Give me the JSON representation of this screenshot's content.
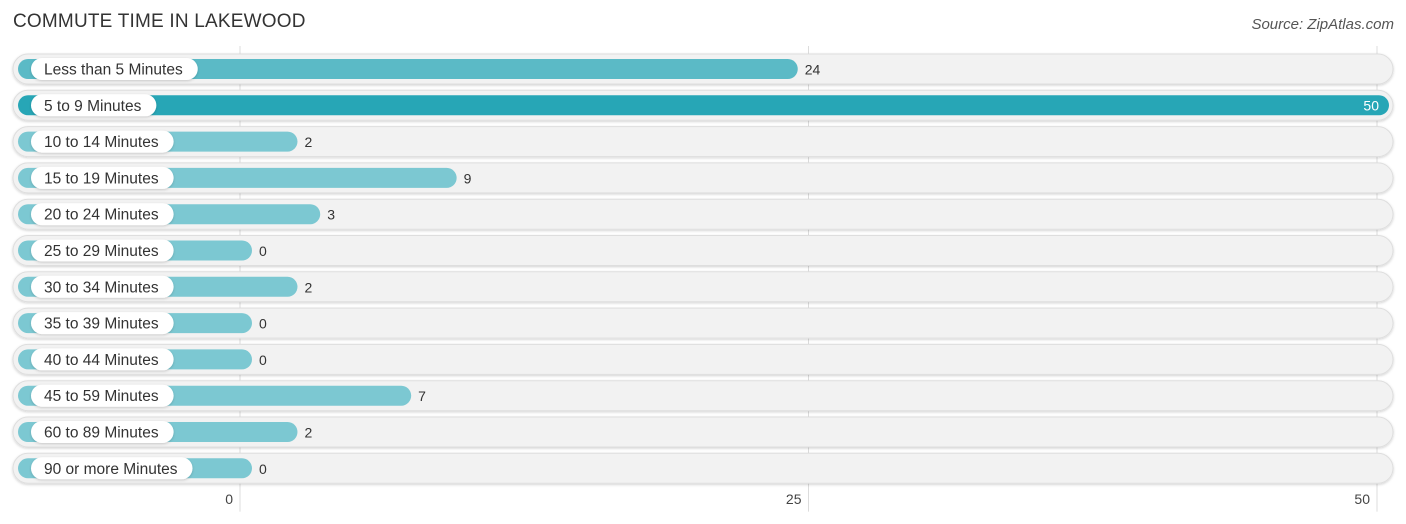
{
  "chart_data": {
    "type": "bar",
    "orientation": "horizontal",
    "title": "COMMUTE TIME IN LAKEWOOD",
    "source": "Source: ZipAtlas.com",
    "categories": [
      "Less than 5 Minutes",
      "5 to 9 Minutes",
      "10 to 14 Minutes",
      "15 to 19 Minutes",
      "20 to 24 Minutes",
      "25 to 29 Minutes",
      "30 to 34 Minutes",
      "35 to 39 Minutes",
      "40 to 44 Minutes",
      "45 to 59 Minutes",
      "60 to 89 Minutes",
      "90 or more Minutes"
    ],
    "values": [
      24,
      50,
      2,
      9,
      3,
      0,
      2,
      0,
      0,
      7,
      2,
      0
    ],
    "xlim": [
      0,
      50
    ],
    "xticks": [
      0,
      25,
      50
    ],
    "xtick_labels": [
      "0",
      "25",
      "50"
    ],
    "xlabel": "",
    "ylabel": "",
    "grid": true,
    "colors": {
      "bar": "#7cc8d2",
      "bar_max": "#27a6b6",
      "bar_high": "#5bbac6",
      "track": "#f2f2f2"
    }
  }
}
